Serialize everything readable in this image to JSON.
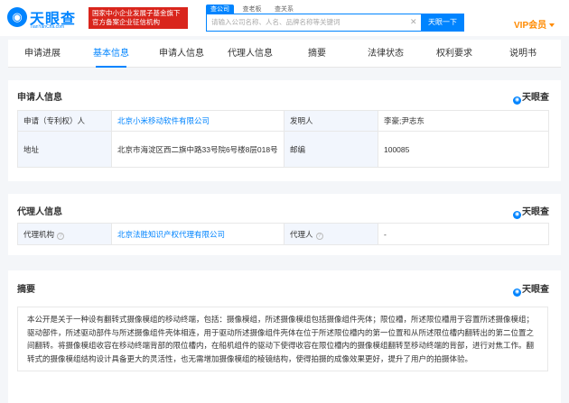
{
  "header": {
    "logo_text": "天眼查",
    "logo_sub": "TianYanCha.com",
    "gov_badge_line1": "国家中小企业发展子基金旗下",
    "gov_badge_line2": "官方备案企业征信机构",
    "search_tabs": [
      "查公司",
      "查老板",
      "查关系"
    ],
    "search_placeholder": "请输入公司名称、人名、品牌名称等关键词",
    "search_button": "天眼一下",
    "vip_label": "VIP会员"
  },
  "tabs": [
    "申请进展",
    "基本信息",
    "申请人信息",
    "代理人信息",
    "摘要",
    "法律状态",
    "权利要求",
    "说明书"
  ],
  "active_tab": "基本信息",
  "brand_mark": "天眼查",
  "applicant": {
    "title": "申请人信息",
    "rows": [
      {
        "label1": "申请（专利权）人",
        "value1": "北京小米移动软件有限公司",
        "label2": "发明人",
        "value2": "李豪;尹志东"
      },
      {
        "label1": "地址",
        "value1": "北京市海淀区西二旗中路33号院6号楼8层018号",
        "label2": "邮编",
        "value2": "100085"
      }
    ]
  },
  "agent": {
    "title": "代理人信息",
    "label1": "代理机构",
    "value1": "北京法胜知识产权代理有限公司",
    "label2": "代理人",
    "value2": "-"
  },
  "summary": {
    "title": "摘要",
    "text": "本公开是关于一种设有翻转式摄像模组的移动终端，包括：摄像模组，所述摄像模组包括摄像组件壳体；限位槽，所述限位槽用于容置所述摄像模组；驱动部件，所述驱动部件与所述摄像组件壳体相连，用于驱动所述摄像组件壳体在位于所述限位槽内的第一位置和从所述限位槽内翻转出的第二位置之间翻转。将摄像模组收容在移动终端背部的限位槽内，在船机组件的驱动下使得收容在限位槽内的摄像模组翻转至移动终端的背部，进行对焦工作。翻转式的摄像模组结构设计具备更大的灵活性，也无需增加摄像模组的棱镜结构，使得拍摄的成像效果更好，提升了用户的拍摄体验。"
  },
  "colors": {
    "accent": "#0084ff",
    "badge": "#d9251c",
    "vip": "#ff8a00"
  }
}
